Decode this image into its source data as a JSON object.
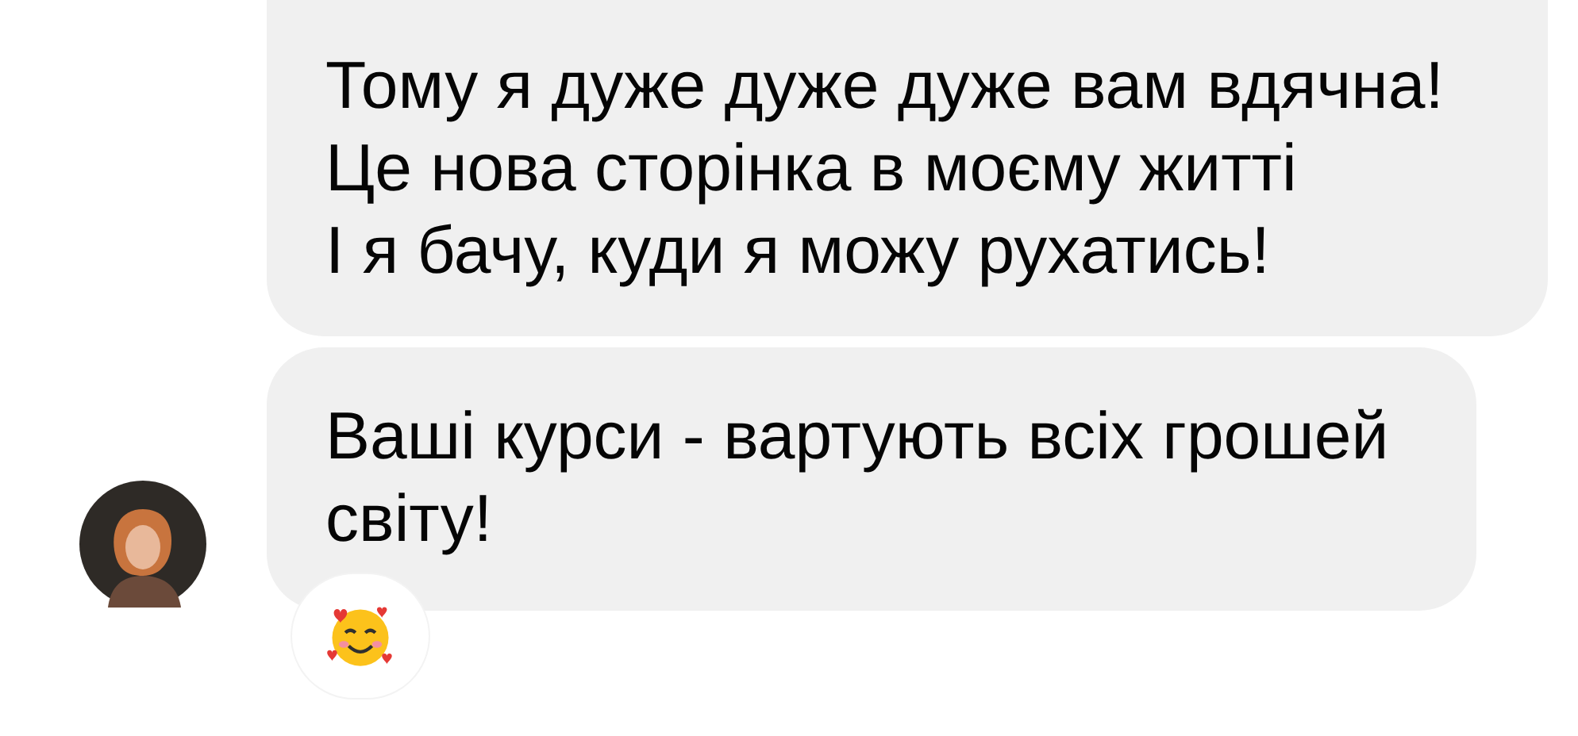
{
  "messages": [
    {
      "lines": [
        "Тому я дуже дуже дуже вам вдячна!",
        "Це нова сторінка в моєму житті",
        "І я бачу, куди я можу рухатись!"
      ],
      "avatar": false
    },
    {
      "lines": [
        "Ваші курси - вартують всіх грошей світу!"
      ],
      "avatar": true,
      "reaction": {
        "kind": "smiling-hearts"
      }
    }
  ]
}
